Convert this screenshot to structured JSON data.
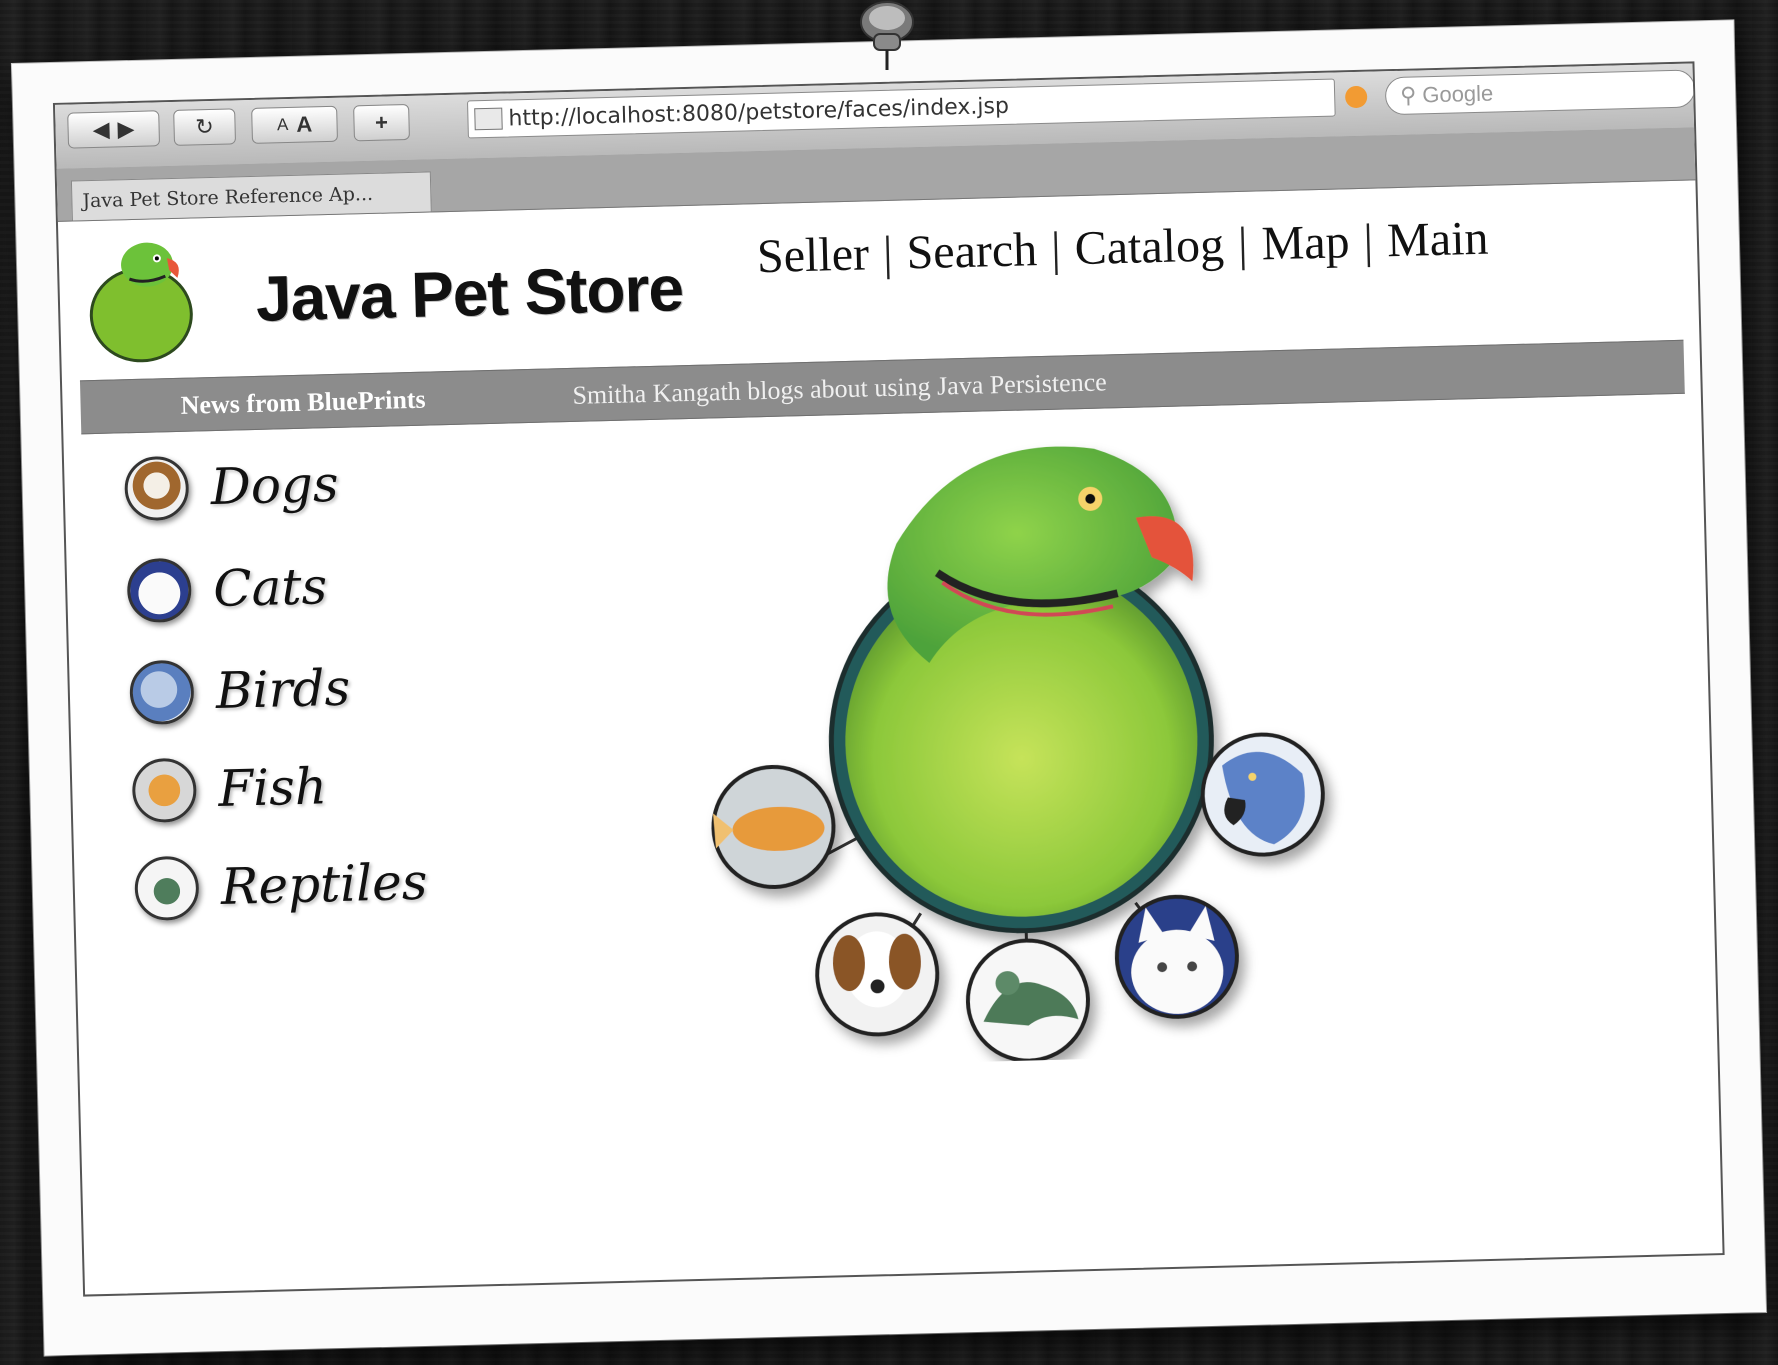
{
  "browser": {
    "url": "http://localhost:8080/petstore/faces/index.jsp",
    "search_placeholder": "Google",
    "tab_title": "Java Pet Store Reference Ap...",
    "font_small": "A",
    "font_large": "A",
    "add": "+"
  },
  "header": {
    "brand": "Java Pet Store",
    "nav": [
      "Seller",
      "Search",
      "Catalog",
      "Map",
      "Main"
    ],
    "separator": "|"
  },
  "news": {
    "label": "News from BluePrints",
    "headline": "Smitha Kangath blogs about using Java Persistence"
  },
  "categories": [
    "Dogs",
    "Cats",
    "Birds",
    "Fish",
    "Reptiles"
  ],
  "colors": {
    "parrot_green": "#8ccf3a",
    "beak": "#e8573a",
    "news_bar": "#8c8c8c"
  }
}
